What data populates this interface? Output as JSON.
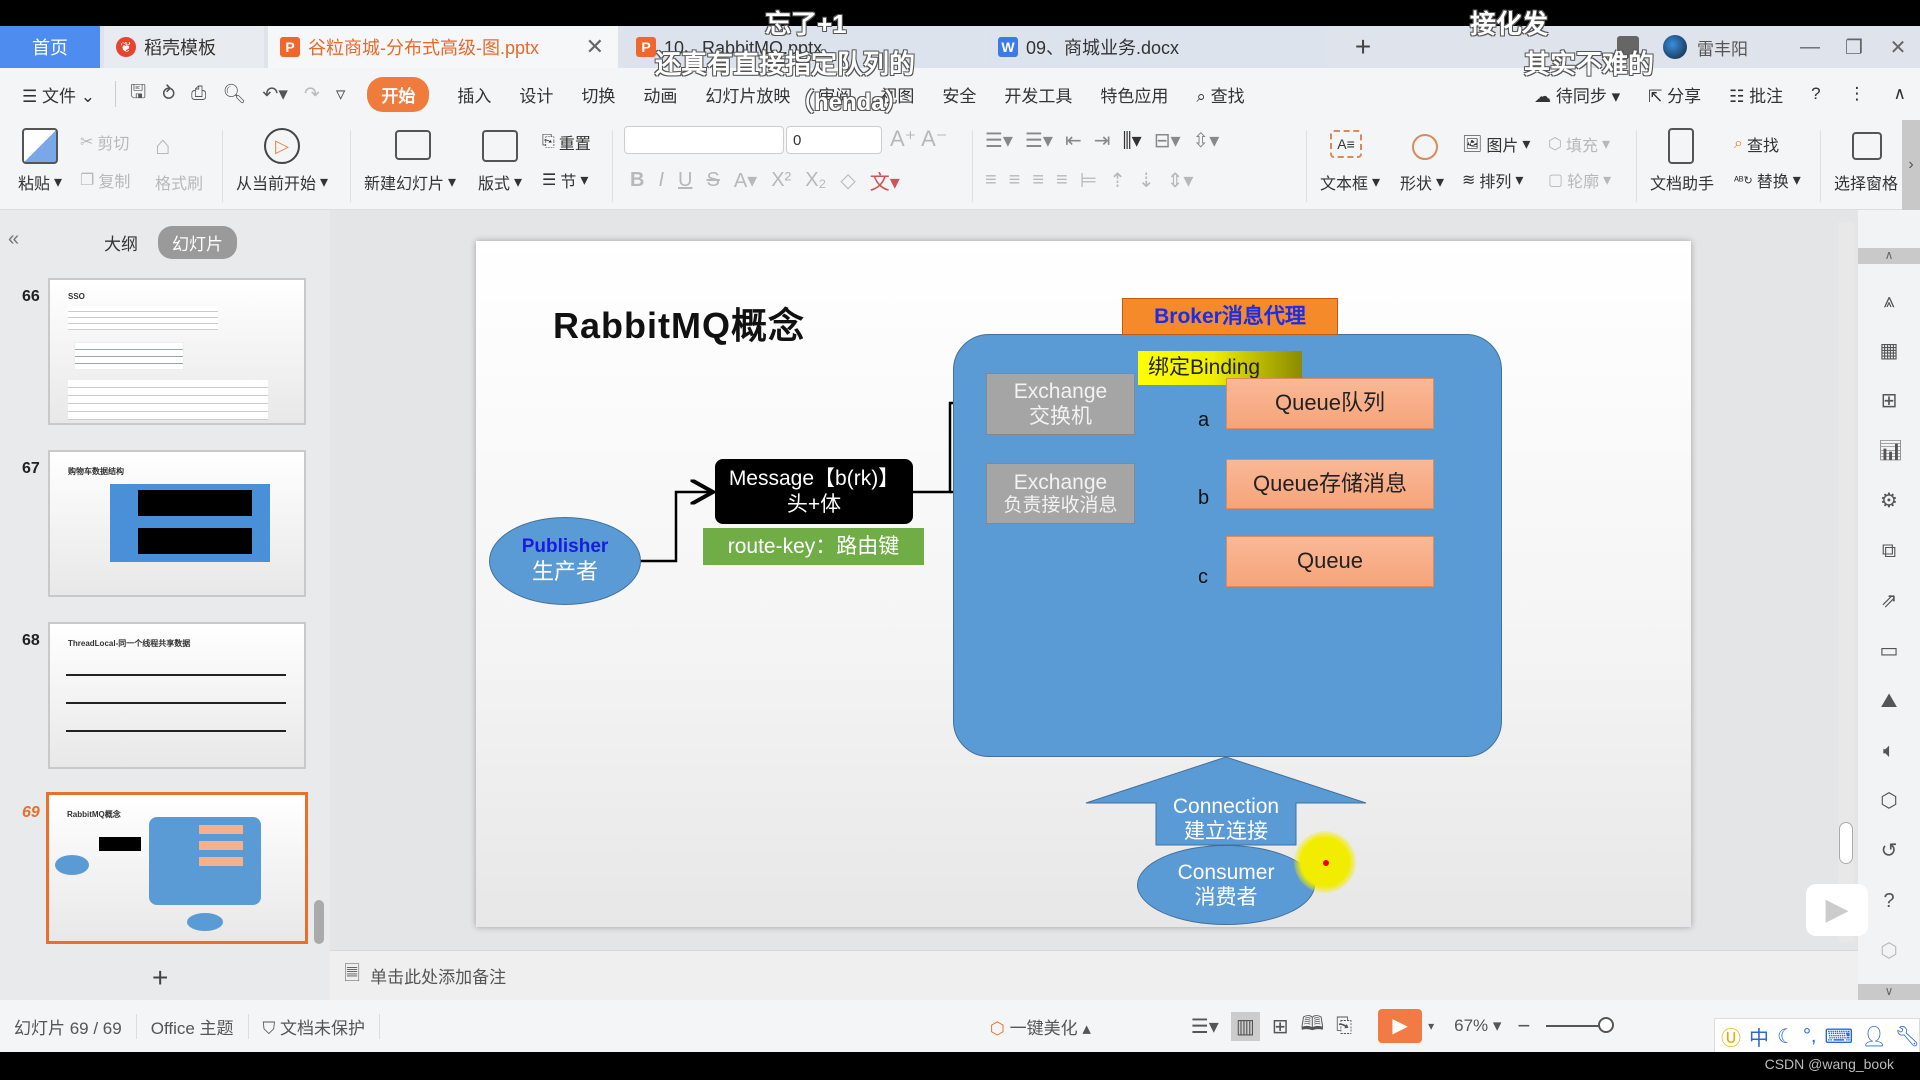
{
  "tabs": {
    "home": "首页",
    "template": "稻壳模板",
    "active_file": "谷粒商城-分布式高级-图.pptx",
    "file2": "10、RabbitMQ.pptx",
    "file3": "09、商城业务.docx",
    "add": "+"
  },
  "user": {
    "name": "雷丰阳"
  },
  "window_controls": {
    "minimize": "—",
    "restore": "❐",
    "close": "✕"
  },
  "menu": {
    "file": "文件",
    "items": [
      "开始",
      "插入",
      "设计",
      "切换",
      "动画",
      "幻灯片放映",
      "审阅",
      "视图",
      "安全",
      "开发工具",
      "特色应用"
    ],
    "active": "开始",
    "search": "查找",
    "right": [
      "待同步",
      "分享",
      "批注"
    ]
  },
  "ribbon": {
    "paste": "粘贴",
    "cut": "剪切",
    "copy": "复制",
    "format_painter": "格式刷",
    "from_current": "从当前开始",
    "new_slide": "新建幻灯片",
    "layout": "版式",
    "reset": "重置",
    "section": "节",
    "font_size": "0",
    "textbox": "文本框",
    "shape": "形状",
    "picture": "图片",
    "arrange": "排列",
    "fill": "填充",
    "outline": "轮廓",
    "doc_assistant": "文档助手",
    "find": "查找",
    "replace": "替换",
    "select_pane": "选择窗格"
  },
  "left_pane": {
    "collapse": "«",
    "outline_tab": "大纲",
    "slides_tab": "幻灯片",
    "thumbnails": [
      {
        "num": "66",
        "title": "SSO"
      },
      {
        "num": "67",
        "title": "购物车数据结构"
      },
      {
        "num": "68",
        "title": "ThreadLocal-同一个线程共享数据"
      },
      {
        "num": "69",
        "title": "RabbitMQ概念",
        "selected": true
      }
    ],
    "add": "+"
  },
  "slide": {
    "title": "RabbitMQ概念",
    "broker": "Broker消息代理",
    "binding": "绑定Binding",
    "exchange1": [
      "Exchange",
      "交换机"
    ],
    "exchange2": [
      "Exchange",
      "负责接收消息"
    ],
    "queues": [
      "Queue队列",
      "Queue存储消息",
      "Queue"
    ],
    "routes": [
      "a",
      "b",
      "c"
    ],
    "message": [
      "Message【b(rk)】",
      "头+体"
    ],
    "route_key": "route-key：路由键",
    "publisher": [
      "Publisher",
      "生产者"
    ],
    "connection": [
      "Connection",
      "建立连接"
    ],
    "consumer": [
      "Consumer",
      "消费者"
    ]
  },
  "notes_placeholder": "单击此处添加备注",
  "status": {
    "slide_counter": "幻灯片 69 / 69",
    "theme": "Office 主题",
    "protection": "文档未保护",
    "beautify": "一键美化",
    "zoom": "67%"
  },
  "overlay_comments": [
    "忘了+1",
    "还真有直接指定队列的",
    "（henda）",
    "接化发",
    "其实不难的"
  ],
  "watermark": "CSDN @wang_book",
  "colors": {
    "accent": "#ef7b3d",
    "broker_blue": "#5b9bd5",
    "queue_orange": "#f8b08a",
    "exchange_gray": "#a5a5a5",
    "route_green": "#70ad47"
  }
}
